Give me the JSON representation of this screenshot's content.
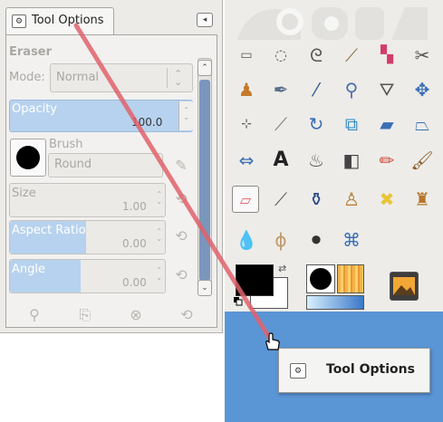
{
  "dock": {
    "tab_label": "Tool Options",
    "tab_icon": "tool-options-icon",
    "menu_icon": "dock-menu-icon"
  },
  "eraser": {
    "title": "Eraser",
    "mode_label": "Mode:",
    "mode_value": "Normal",
    "opacity_label": "Opacity",
    "opacity_value": "100.0",
    "brush_label": "Brush",
    "brush_value": "Round",
    "size_label": "Size",
    "size_value": "1.00",
    "aspect_label": "Aspect Ratio",
    "aspect_value": "0.00",
    "angle_label": "Angle",
    "angle_value": "0.00"
  },
  "bottom_buttons": [
    "save-options-icon",
    "restore-options-icon",
    "delete-options-icon",
    "reset-options-icon"
  ],
  "toolbox": {
    "tools": [
      "rect-select-icon",
      "ellipse-select-icon",
      "free-select-icon",
      "fuzzy-select-icon",
      "color-select-icon",
      "scissors-icon",
      "foreground-select-icon",
      "paths-icon",
      "color-picker-icon",
      "zoom-icon",
      "measure-icon",
      "move-icon",
      "align-icon",
      "crop-icon",
      "rotate-icon",
      "scale-icon",
      "shear-icon",
      "perspective-icon",
      "flip-icon",
      "text-icon",
      "bucket-fill-icon",
      "blend-icon",
      "pencil-icon",
      "paintbrush-icon",
      "eraser-icon",
      "airbrush-icon",
      "ink-icon",
      "clone-icon",
      "heal-icon",
      "perspective-clone-icon",
      "blur-icon",
      "smudge-icon",
      "dodge-burn-icon",
      "cage-transform-icon"
    ],
    "active_tool": "eraser-icon",
    "fg_color": "#000000",
    "bg_color": "#ffffff"
  },
  "popup": {
    "label": "Tool Options"
  },
  "colors": {
    "drop_zone": "#5a95d6",
    "drag_line": "#e0626b",
    "selection_blue": "#b7d2ee"
  }
}
